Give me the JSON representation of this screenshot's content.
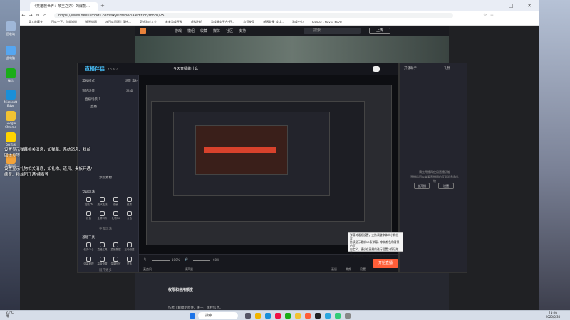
{
  "desktop": {
    "icons": [
      {
        "label": "回收站",
        "color": "#9fb7d8"
      },
      {
        "label": "此电脑",
        "color": "#56a6f0"
      },
      {
        "label": "微信",
        "color": "#1aad19"
      },
      {
        "label": "Microsoft Edge",
        "color": "#1a8fd8"
      },
      {
        "label": "Google Chrome",
        "color": "#f1c232"
      },
      {
        "label": "QQ音乐",
        "color": "#ffd400"
      },
      {
        "label": "直播伴侣",
        "color": "#f3a33a"
      }
    ],
    "message_line1": "设置显示弹幕相关消息，如弹幕、系统消息、粉丝团信息等",
    "message_line2": "设置显示礼物相关消息，如礼物、道具、贵族开通/续费、粉丝团开通/续费等"
  },
  "browser": {
    "tab_title": "《英雄救世界：帝王之刃》的爆款…",
    "url": "https://www.nexusmods.com/skyrimspecialedition/mods/25",
    "bookmarks": [
      "导入收藏夹",
      "百度一下，你就知道",
      "钢琴谱网",
      "从百度问题 | 保持…",
      "奇迹游戏大全",
      "未来游戏开发",
      "虚拟主机",
      "游戏服务平台-开…",
      "欢迎使用",
      "新闻联播_文字..",
      "游戏中心",
      "Games - Nexus Mods"
    ],
    "window_controls": [
      "–",
      "□",
      "✕"
    ]
  },
  "site": {
    "nav": [
      "游戏",
      "模组",
      "收藏",
      "媒体",
      "社区",
      "支持"
    ],
    "search_placeholder": "搜索",
    "upload_label": "上传",
    "section_title": "权限和信用额度",
    "paragraph": "作者了解模组原件、关于、版权信息。"
  },
  "app": {
    "logo": "直播伴侣",
    "version": "4.5.6.2",
    "title": "今天直播做什么",
    "tabs": [
      "场景",
      "素材"
    ],
    "left_section": "常规模式",
    "scene_header": "我的场景",
    "add_label": "添加",
    "scene_group": "直播场景 1",
    "scene_item": "直播",
    "add_material": "添加素材",
    "interaction_title": "互动玩法",
    "interaction_items": [
      "连线PK",
      "观众连线",
      "福袋",
      "投票",
      "红包",
      "全屏口令",
      "礼物PK",
      "公告"
    ],
    "more_label": "更多玩法",
    "tools_title": "基础工具",
    "tool_items": [
      "任务中心",
      "直播工具",
      "直播数据",
      "互动设置",
      "弹幕管理",
      "高级设置",
      "录制回放",
      "更多"
    ],
    "more_tools": "展开更多",
    "mic_label": "麦克风",
    "speaker_label": "扬声器",
    "mic_value": "100%",
    "speaker_value": "60%",
    "bottom_actions": [
      "画质",
      "美颜",
      "设置"
    ],
    "start_label": "开始直播",
    "right_tabs": [
      "开播助手",
      "礼物"
    ],
    "right_hint1": "请先开播再使用直播功能",
    "right_hint2": "开播后可以查看直播间的互动消息和礼物",
    "right_btns": [
      "去开播",
      "设置"
    ]
  },
  "tooltip": {
    "lines": [
      "弹幕对话框设置，支持调整字体大小和位置，",
      "持续显示最新10条弹幕，字体颜色和背景色可",
      "自定义。建议在直播前进行设置以保证效果，",
      "可随时修改。可在设置中查看详情。"
    ]
  },
  "taskbar": {
    "weather_temp": "23°C",
    "weather_desc": "晴",
    "search": "搜索",
    "time": "19:09",
    "date": "2025/5/30"
  },
  "colors": {
    "accent_orange": "#ff5e38",
    "logo_blue": "#49c4ff",
    "dark_bg": "#1e1f27"
  }
}
